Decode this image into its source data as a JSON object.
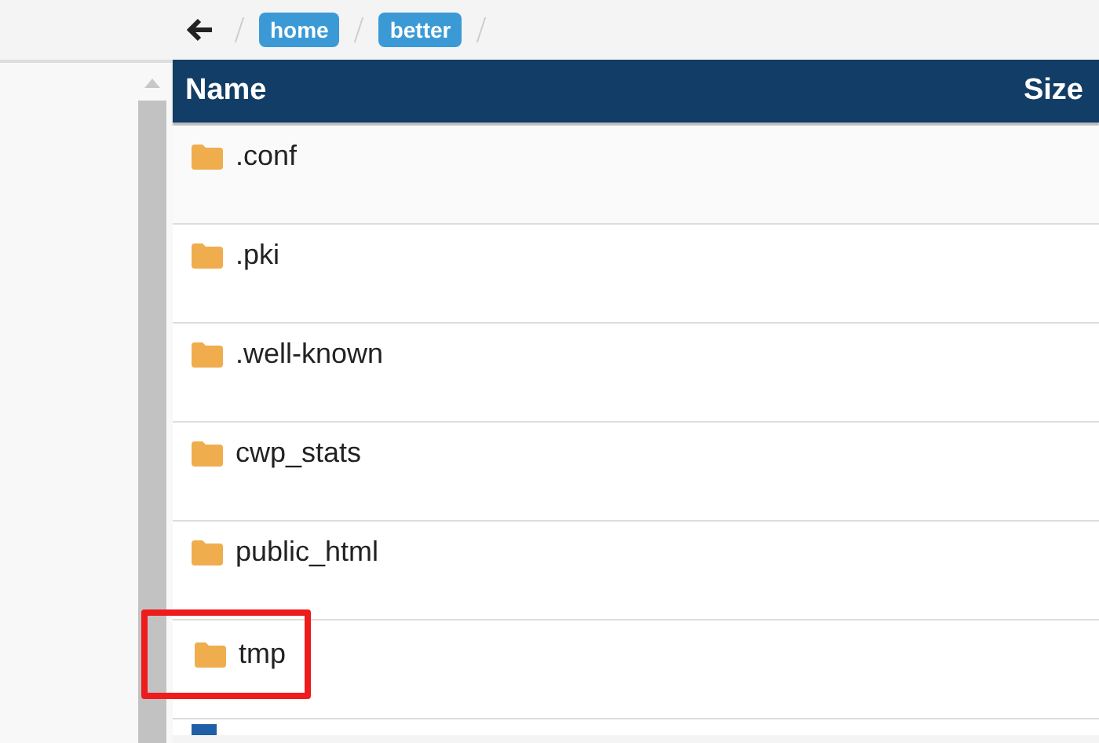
{
  "breadcrumb": [
    "home",
    "better"
  ],
  "table": {
    "columns": [
      "Name",
      "Size"
    ],
    "rows": [
      {
        "kind": "folder",
        "name": ".conf",
        "highlighted": false
      },
      {
        "kind": "folder",
        "name": ".pki",
        "highlighted": false
      },
      {
        "kind": "folder",
        "name": ".well-known",
        "highlighted": false
      },
      {
        "kind": "folder",
        "name": "cwp_stats",
        "highlighted": false
      },
      {
        "kind": "folder",
        "name": "public_html",
        "highlighted": false
      },
      {
        "kind": "folder",
        "name": "tmp",
        "highlighted": true
      },
      {
        "kind": "file",
        "highlighted": false
      }
    ]
  }
}
